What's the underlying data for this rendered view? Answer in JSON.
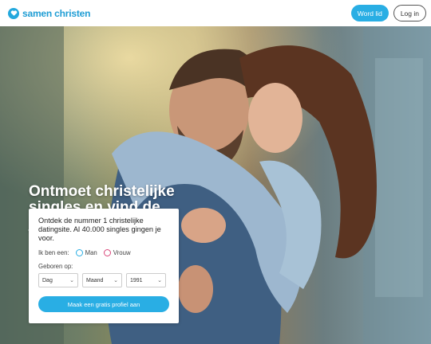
{
  "header": {
    "logo_text": "samen christen",
    "join_label": "Word lid",
    "login_label": "Log in"
  },
  "hero": {
    "headline": "Ontmoet christelijke singles en vind de juiste match"
  },
  "signup_card": {
    "intro": "Ontdek de nummer 1 christelijke datingsite. Al 40.000 singles gingen je voor.",
    "gender_label": "Ik ben een:",
    "gender_options": [
      "Man",
      "Vrouw"
    ],
    "dob_label": "Geboren op:",
    "day_value": "Dag",
    "month_value": "Maand",
    "year_value": "1991",
    "cta_label": "Maak een gratis profiel aan"
  },
  "colors": {
    "brand": "#1f9dd4",
    "button": "#29aee4",
    "radio_female": "#d9477a"
  }
}
